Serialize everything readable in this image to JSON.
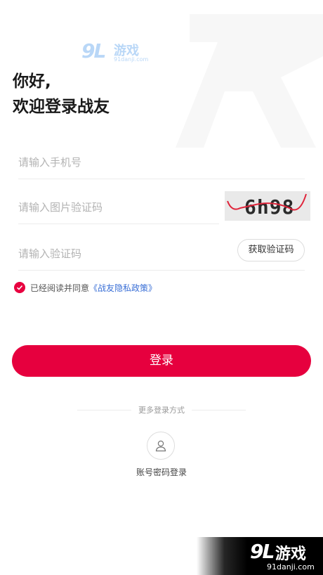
{
  "watermark_top": {
    "num": "9L",
    "cn": "游戏",
    "domain": "91danji.com"
  },
  "greeting": {
    "line1": "你好,",
    "line2": "欢迎登录战友"
  },
  "form": {
    "phone_placeholder": "请输入手机号",
    "image_code_placeholder": "请输入图片验证码",
    "captcha_text": "6h98",
    "sms_code_placeholder": "请输入验证码",
    "get_code_label": "获取验证码"
  },
  "agreement": {
    "text": "已经阅读并同意",
    "link": "《战友隐私政策》",
    "checked": true
  },
  "login_button": "登录",
  "more_login": {
    "label": "更多登录方式",
    "account_label": "账号密码登录"
  },
  "watermark_bottom": {
    "num": "9L",
    "cn": "游戏",
    "domain": "91danji.com"
  },
  "colors": {
    "accent": "#e6003e",
    "link": "#3a6fd6"
  }
}
